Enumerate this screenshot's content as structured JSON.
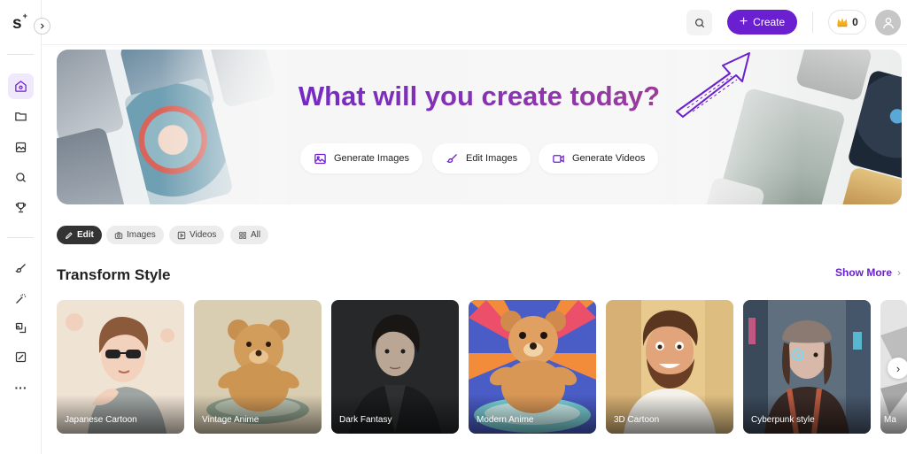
{
  "app": {
    "logo": "s",
    "logo_mark": "+"
  },
  "sidebar": {
    "items": [
      {
        "icon": "home-icon",
        "active": true
      },
      {
        "icon": "folder-icon",
        "active": false
      },
      {
        "icon": "gallery-icon",
        "active": false
      },
      {
        "icon": "search-icon",
        "active": false
      },
      {
        "icon": "trophy-icon",
        "active": false
      },
      {
        "icon": "brush-icon",
        "active": false
      },
      {
        "icon": "magic-wand-icon",
        "active": false
      },
      {
        "icon": "image-edit-icon",
        "active": false
      },
      {
        "icon": "crop-icon",
        "active": false
      },
      {
        "icon": "more-icon",
        "active": false
      }
    ],
    "more_label": "···"
  },
  "topbar": {
    "create_label": "Create",
    "credits": "0",
    "colors": {
      "accent": "#6a1fd0"
    }
  },
  "hero": {
    "title": "What will you create today?",
    "buttons": [
      {
        "label": "Generate Images",
        "icon": "image-icon"
      },
      {
        "label": "Edit Images",
        "icon": "brush-icon"
      },
      {
        "label": "Generate Videos",
        "icon": "video-icon"
      }
    ]
  },
  "filters": [
    {
      "label": "Edit",
      "active": true,
      "icon": "pencil-icon"
    },
    {
      "label": "Images",
      "active": false,
      "icon": "camera-icon"
    },
    {
      "label": "Videos",
      "active": false,
      "icon": "play-icon"
    },
    {
      "label": "All",
      "active": false,
      "icon": "grid-icon"
    }
  ],
  "section": {
    "title": "Transform Style",
    "show_more": "Show More",
    "cards": [
      {
        "label": "Japanese Cartoon"
      },
      {
        "label": "Vintage Anime"
      },
      {
        "label": "Dark Fantasy"
      },
      {
        "label": "Modern Anime"
      },
      {
        "label": "3D Cartoon"
      },
      {
        "label": "Cyberpunk style"
      },
      {
        "label": "Ma"
      }
    ]
  }
}
